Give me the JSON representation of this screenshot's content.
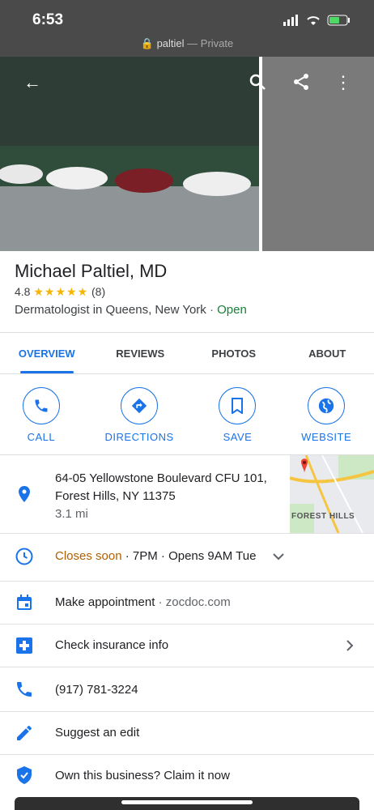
{
  "status": {
    "time": "6:53",
    "url": "paltiel",
    "privacy": "— Private"
  },
  "place": {
    "name": "Michael Paltiel, MD",
    "rating": "4.8",
    "stars": "★★★★★",
    "reviews": "(8)",
    "category": "Dermatologist in Queens, New York",
    "sep": "·",
    "open": "Open"
  },
  "tabs": [
    {
      "label": "OVERVIEW"
    },
    {
      "label": "REVIEWS"
    },
    {
      "label": "PHOTOS"
    },
    {
      "label": "ABOUT"
    }
  ],
  "actions": [
    {
      "label": "CALL"
    },
    {
      "label": "DIRECTIONS"
    },
    {
      "label": "SAVE"
    },
    {
      "label": "WEBSITE"
    }
  ],
  "address": {
    "line1": "64-05 Yellowstone Boulevard CFU 101,",
    "line2": "Forest Hills, NY 11375",
    "distance": "3.1 mi",
    "map_label": "FOREST HILLS"
  },
  "hours": {
    "status": "Closes soon",
    "close": "· 7PM ·",
    "opens": "Opens 9AM Tue"
  },
  "appointment": {
    "label": "Make appointment",
    "source": "· zocdoc.com"
  },
  "insurance": {
    "label": "Check insurance info"
  },
  "phone": {
    "number": "(917) 781-3224"
  },
  "suggest": {
    "label": "Suggest an edit"
  },
  "claim": {
    "label": "Own this business? Claim it now"
  },
  "colors": {
    "accent": "#1a73e8",
    "open": "#188038",
    "closes_soon": "#b06000",
    "star": "#f7b500"
  }
}
